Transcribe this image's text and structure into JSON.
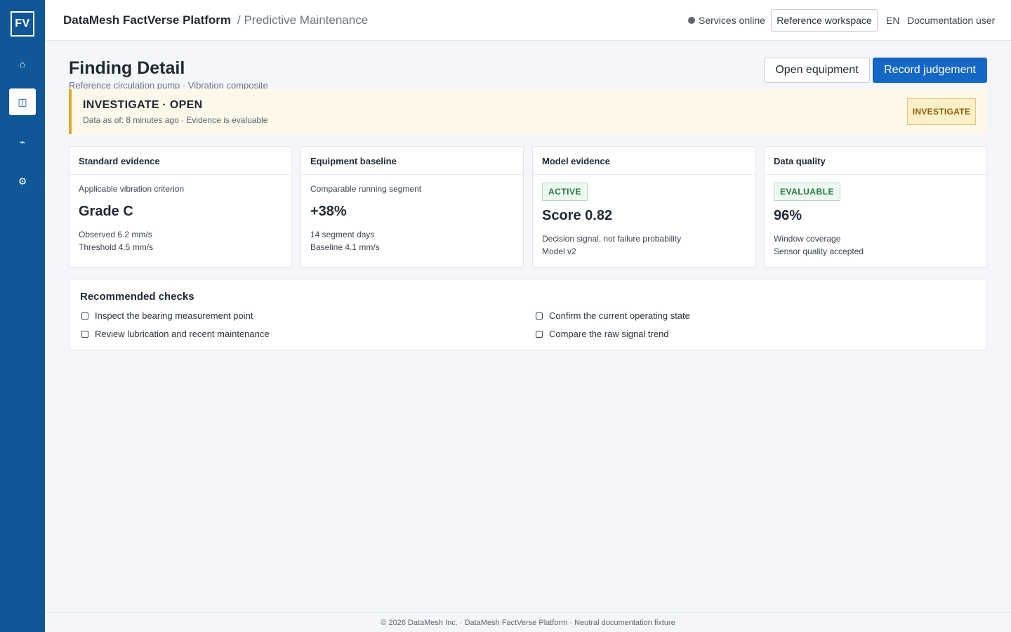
{
  "sidebar": {
    "logo": "FV",
    "items": [
      {
        "icon": "home-icon",
        "glyph": "⌂",
        "active": false
      },
      {
        "icon": "panels-icon",
        "glyph": "◫",
        "active": true
      },
      {
        "icon": "signal-icon",
        "glyph": "⌁",
        "active": false
      },
      {
        "icon": "gear-icon",
        "glyph": "⚙",
        "active": false
      }
    ]
  },
  "topbar": {
    "brand": "DataMesh FactVerse Platform",
    "breadcrumb": "/ Predictive Maintenance",
    "status": "Services online",
    "workspace_button": "Reference workspace",
    "language": "EN",
    "user": "Documentation user"
  },
  "page": {
    "title": "Finding Detail",
    "subtitle": "Reference circulation pump · Vibration composite",
    "open_equipment": "Open equipment",
    "record_judgement": "Record judgement"
  },
  "banner": {
    "title": "INVESTIGATE · OPEN",
    "subtitle": "Data as of: 8 minutes ago · Evidence is evaluable",
    "badge": "INVESTIGATE"
  },
  "cards": [
    {
      "title": "Standard evidence",
      "label": "Applicable vibration criterion",
      "value": "Grade C",
      "line1": "Observed 6.2 mm/s",
      "line2": "Threshold 4.5 mm/s"
    },
    {
      "title": "Equipment baseline",
      "label": "Comparable running segment",
      "value": "+38%",
      "line1": "14 segment days",
      "line2": "Baseline 4.1 mm/s"
    },
    {
      "title": "Model evidence",
      "badge": "ACTIVE",
      "value": "Score 0.82",
      "line1": "Decision signal, not failure probability",
      "line2": "Model v2"
    },
    {
      "title": "Data quality",
      "badge": "EVALUABLE",
      "value": "96%",
      "line1": "Window coverage",
      "line2": "Sensor quality accepted"
    }
  ],
  "checks": {
    "title": "Recommended checks",
    "items": [
      "Inspect the bearing measurement point",
      "Confirm the current operating state",
      "Review lubrication and recent maintenance",
      "Compare the raw signal trend"
    ]
  },
  "footer": "© 2026 DataMesh Inc. · DataMesh FactVerse Platform · Neutral documentation fixture",
  "colors": {
    "sidebar": "#0f5796",
    "primary": "#1467c4",
    "warning_accent": "#e0a92a",
    "success": "#1e7a3d"
  }
}
